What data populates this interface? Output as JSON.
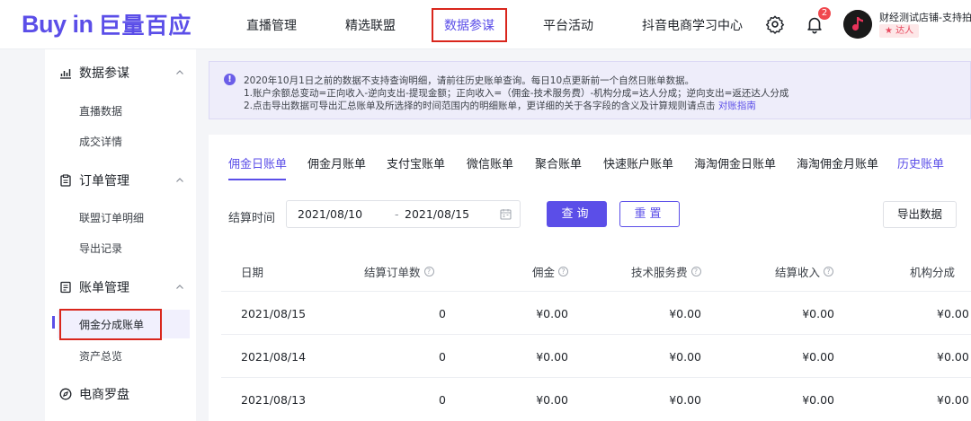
{
  "header": {
    "logo_en": "Buy in",
    "logo_cn": "巨量百应",
    "nav": [
      "直播管理",
      "精选联盟",
      "数据参谋",
      "平台活动",
      "抖音电商学习中心"
    ],
    "active_nav_index": 2,
    "notification_count": "2",
    "user_name": "财经测试店铺-支持拍",
    "user_tag": "达人",
    "icons": [
      "gear-icon",
      "bell-icon",
      "avatar"
    ]
  },
  "sidebar": {
    "groups": [
      {
        "label": "数据参谋",
        "icon": "chart-icon",
        "items": [
          "直播数据",
          "成交详情"
        ]
      },
      {
        "label": "订单管理",
        "icon": "clipboard-icon",
        "items": [
          "联盟订单明细",
          "导出记录"
        ]
      },
      {
        "label": "账单管理",
        "icon": "document-icon",
        "items": [
          "佣金分成账单",
          "资产总览"
        ]
      },
      {
        "label": "电商罗盘",
        "icon": "compass-icon",
        "items": []
      }
    ],
    "active_item": "佣金分成账单"
  },
  "notice": {
    "line1": "2020年10月1日之前的数据不支持查询明细，请前往历史账单查询。每日10点更新前一个自然日账单数据。",
    "line2": "1.账户余额总变动=正向收入-逆向支出-提现金额；正向收入=（佣金-技术服务费）-机构分成=达人分成；逆向支出=返还达人分成",
    "line3_text": "2.点击导出数据可导出汇总账单及所选择的时间范围内的明细账单，更详细的关于各字段的含义及计算规则请点击",
    "line3_link": "对账指南"
  },
  "tabs": [
    "佣金日账单",
    "佣金月账单",
    "支付宝账单",
    "微信账单",
    "聚合账单",
    "快速账户账单",
    "海淘佣金日账单",
    "海淘佣金月账单",
    "历史账单"
  ],
  "active_tab": "佣金日账单",
  "filter": {
    "label": "结算时间",
    "start_date": "2021/08/10",
    "separator": "-",
    "end_date": "2021/08/15",
    "query_label": "查询",
    "reset_label": "重置",
    "export_label": "导出数据"
  },
  "table": {
    "columns": [
      "日期",
      "结算订单数",
      "佣金",
      "技术服务费",
      "结算收入",
      "机构分成"
    ],
    "rows": [
      [
        "2021/08/15",
        "0",
        "¥0.00",
        "¥0.00",
        "¥0.00",
        "¥0.00"
      ],
      [
        "2021/08/14",
        "0",
        "¥0.00",
        "¥0.00",
        "¥0.00",
        "¥0.00"
      ],
      [
        "2021/08/13",
        "0",
        "¥0.00",
        "¥0.00",
        "¥0.00",
        "¥0.00"
      ]
    ]
  },
  "colors": {
    "accent": "#5b4ee8",
    "highlight_box": "#d9261c",
    "badge": "#f0484e"
  }
}
